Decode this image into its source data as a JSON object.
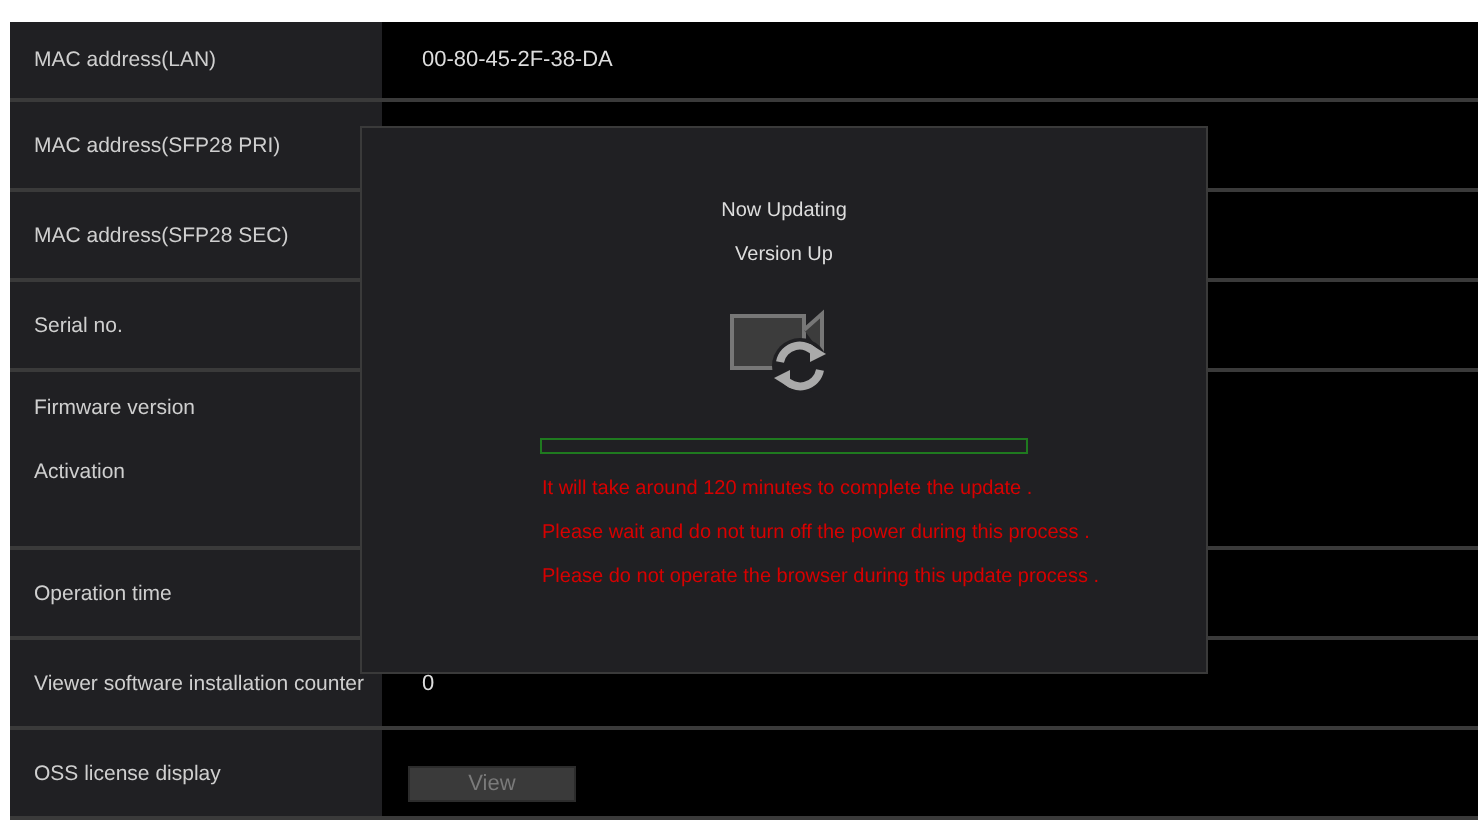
{
  "rows": [
    {
      "kind": "short",
      "labels": [
        "MAC address(LAN)"
      ],
      "value": "00-80-45-2F-38-DA"
    },
    {
      "kind": "normal",
      "labels": [
        "MAC address(SFP28 PRI)"
      ]
    },
    {
      "kind": "normal",
      "labels": [
        "MAC address(SFP28 SEC)"
      ]
    },
    {
      "kind": "normal",
      "labels": [
        "Serial no."
      ]
    },
    {
      "kind": "tall",
      "labels": [
        "Firmware version",
        "Activation"
      ]
    },
    {
      "kind": "normal",
      "labels": [
        "Operation time"
      ]
    },
    {
      "kind": "normal",
      "labels": [
        "Viewer software installation counter"
      ],
      "value": "0"
    },
    {
      "kind": "normal",
      "labels": [
        "OSS license display"
      ],
      "button": {
        "label": "View",
        "disabled": true
      }
    }
  ],
  "dialog": {
    "title": "Now Updating",
    "subtitle": "Version Up",
    "progress": {
      "level": 0
    },
    "messages": [
      "It will take around 120 minutes to complete the update .",
      "Please wait and do not turn off the power during this process .",
      "Please do not operate the browser during this update process ."
    ]
  }
}
